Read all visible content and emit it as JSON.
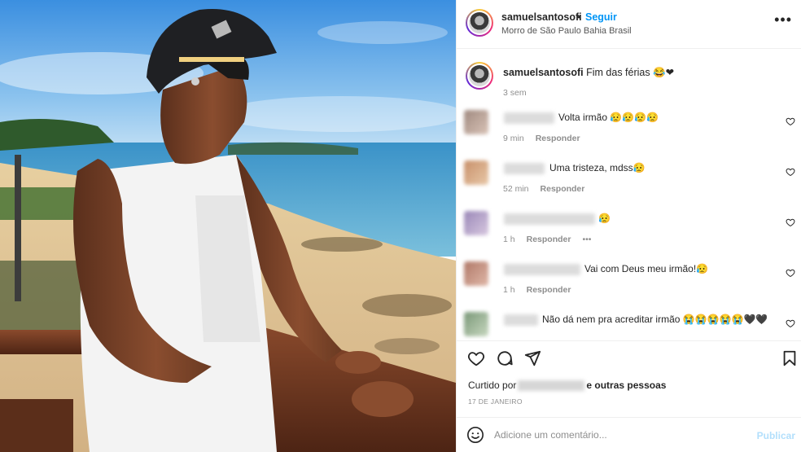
{
  "header": {
    "username": "samuelsantosofi",
    "separator": "•",
    "follow_label": "Seguir",
    "location": "Morro de São Paulo Bahia Brasil",
    "more_label": "•••"
  },
  "caption": {
    "username": "samuelsantosofi",
    "text": "Fim das férias",
    "emojis": "😂❤",
    "time": "3 sem"
  },
  "comments": [
    {
      "text": "Volta irmão",
      "emojis": "😥😥😥😥",
      "time": "9 min",
      "reply": "Responder",
      "more": ""
    },
    {
      "text": "Uma tristeza, mdss",
      "emojis": "😥",
      "time": "52 min",
      "reply": "Responder",
      "more": ""
    },
    {
      "text": "",
      "emojis": "😥",
      "time": "1 h",
      "reply": "Responder",
      "more": "•••"
    },
    {
      "text": "Vai com Deus meu irmão!",
      "emojis": "😥",
      "time": "1 h",
      "reply": "Responder",
      "more": ""
    },
    {
      "text": "Não dá nem pra acreditar irmão",
      "emojis": "😭😭😭😭😭🖤🖤",
      "time": "",
      "reply": "",
      "more": ""
    }
  ],
  "likes": {
    "prefix": "Curtido por",
    "suffix": "e outras pessoas"
  },
  "date": "17 DE JANEIRO",
  "add_comment": {
    "placeholder": "Adicione um comentário...",
    "publish_label": "Publicar"
  },
  "colors": {
    "accent": "#0095f6",
    "publish_disabled": "#b2dffc",
    "muted": "#8e8e8e"
  }
}
